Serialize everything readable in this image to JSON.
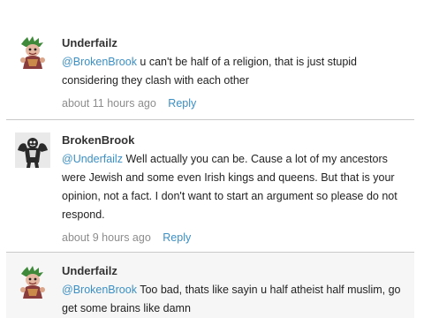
{
  "comments": [
    {
      "author": "Underfailz",
      "mention": "@BrokenBrook",
      "text": " u can't be half of a religion, that is just stupid considering they clash with each other",
      "time": "about 11 hours ago",
      "reply": "Reply",
      "avatar_icon": "cartoon-avatar"
    },
    {
      "author": "BrokenBrook",
      "mention": "@Underfailz",
      "text": " Well actually you can be. Cause a lot of my ancestors were Jewish and some even Irish kings and queens. But that is your opinion, not a fact. I don't want to start an argument so please do not respond.",
      "time": "about 9 hours ago",
      "reply": "Reply",
      "avatar_icon": "muscle-avatar"
    },
    {
      "author": "Underfailz",
      "mention": "@BrokenBrook",
      "text": " Too bad, thats like sayin u half atheist half muslim, go get some brains like damn",
      "avatar_icon": "cartoon-avatar"
    }
  ],
  "colors": {
    "link": "#3b8fc4",
    "meta": "#8d8d8d",
    "divider": "#c9c9c9"
  }
}
